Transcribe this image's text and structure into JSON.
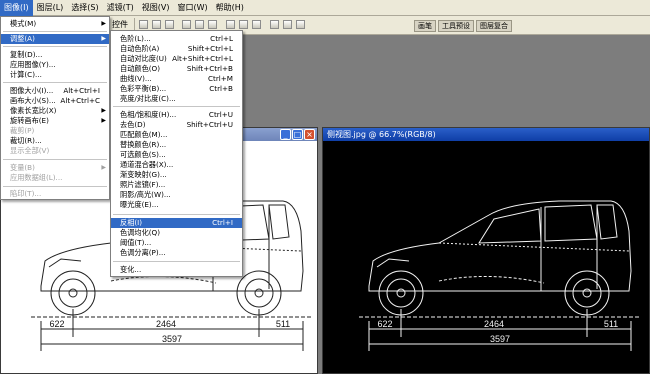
{
  "menubar": {
    "items": [
      "图像(I)",
      "图层(L)",
      "选择(S)",
      "滤镜(T)",
      "视图(V)",
      "窗口(W)",
      "帮助(H)"
    ],
    "active_index": 0
  },
  "options_bar": {
    "control_label": "控件",
    "tabs": [
      "画笔",
      "工具预设",
      "图层复合"
    ]
  },
  "image_menu": {
    "items": [
      {
        "label": "模式(M)",
        "shortcut": "",
        "submenu": true,
        "disabled": false,
        "highlight": false
      },
      {
        "label": "调整(A)",
        "shortcut": "",
        "submenu": true,
        "disabled": false,
        "highlight": true
      },
      {
        "label": "复制(D)...",
        "shortcut": "",
        "submenu": false,
        "disabled": false,
        "highlight": false
      },
      {
        "label": "应用图像(Y)...",
        "shortcut": "",
        "submenu": false,
        "disabled": false,
        "highlight": false
      },
      {
        "label": "计算(C)...",
        "shortcut": "",
        "submenu": false,
        "disabled": false,
        "highlight": false
      },
      {
        "label": "图像大小(I)...",
        "shortcut": "Alt+Ctrl+I",
        "submenu": false,
        "disabled": false,
        "highlight": false
      },
      {
        "label": "画布大小(S)...",
        "shortcut": "Alt+Ctrl+C",
        "submenu": false,
        "disabled": false,
        "highlight": false
      },
      {
        "label": "像素长宽比(X)",
        "shortcut": "",
        "submenu": true,
        "disabled": false,
        "highlight": false
      },
      {
        "label": "旋转画布(E)",
        "shortcut": "",
        "submenu": true,
        "disabled": false,
        "highlight": false
      },
      {
        "label": "裁剪(P)",
        "shortcut": "",
        "submenu": false,
        "disabled": true,
        "highlight": false
      },
      {
        "label": "裁切(R)...",
        "shortcut": "",
        "submenu": false,
        "disabled": false,
        "highlight": false
      },
      {
        "label": "显示全部(V)",
        "shortcut": "",
        "submenu": false,
        "disabled": true,
        "highlight": false
      },
      {
        "label": "变量(B)",
        "shortcut": "",
        "submenu": true,
        "disabled": true,
        "highlight": false
      },
      {
        "label": "应用数据组(L)...",
        "shortcut": "",
        "submenu": false,
        "disabled": true,
        "highlight": false
      },
      {
        "label": "陷印(T)...",
        "shortcut": "",
        "submenu": false,
        "disabled": true,
        "highlight": false
      }
    ]
  },
  "adjust_menu": {
    "items": [
      {
        "label": "色阶(L)...",
        "shortcut": "Ctrl+L",
        "highlight": false
      },
      {
        "label": "自动色阶(A)",
        "shortcut": "Shift+Ctrl+L",
        "highlight": false
      },
      {
        "label": "自动对比度(U)",
        "shortcut": "Alt+Shift+Ctrl+L",
        "highlight": false
      },
      {
        "label": "自动颜色(O)",
        "shortcut": "Shift+Ctrl+B",
        "highlight": false
      },
      {
        "label": "曲线(V)...",
        "shortcut": "Ctrl+M",
        "highlight": false
      },
      {
        "label": "色彩平衡(B)...",
        "shortcut": "Ctrl+B",
        "highlight": false
      },
      {
        "label": "亮度/对比度(C)...",
        "shortcut": "",
        "highlight": false
      },
      {
        "label": "色相/饱和度(H)...",
        "shortcut": "Ctrl+U",
        "highlight": false
      },
      {
        "label": "去色(D)",
        "shortcut": "Shift+Ctrl+U",
        "highlight": false
      },
      {
        "label": "匹配颜色(M)...",
        "shortcut": "",
        "highlight": false
      },
      {
        "label": "替换颜色(R)...",
        "shortcut": "",
        "highlight": false
      },
      {
        "label": "可选颜色(S)...",
        "shortcut": "",
        "highlight": false
      },
      {
        "label": "通道混合器(X)...",
        "shortcut": "",
        "highlight": false
      },
      {
        "label": "渐变映射(G)...",
        "shortcut": "",
        "highlight": false
      },
      {
        "label": "照片滤镜(F)...",
        "shortcut": "",
        "highlight": false
      },
      {
        "label": "阴影/高光(W)...",
        "shortcut": "",
        "highlight": false
      },
      {
        "label": "曝光度(E)...",
        "shortcut": "",
        "highlight": false
      },
      {
        "label": "反相(I)",
        "shortcut": "Ctrl+I",
        "highlight": true
      },
      {
        "label": "色调均化(Q)",
        "shortcut": "",
        "highlight": false
      },
      {
        "label": "阈值(T)...",
        "shortcut": "",
        "highlight": false
      },
      {
        "label": "色调分离(P)...",
        "shortcut": "",
        "highlight": false
      },
      {
        "label": "变化...",
        "shortcut": "",
        "highlight": false
      }
    ]
  },
  "left_window": {
    "dimensions": {
      "front": "622",
      "wheelbase": "2464",
      "rear": "511",
      "total": "3597"
    }
  },
  "right_window": {
    "title": "侧视图.jpg @ 66.7%(RGB/8)",
    "dimensions": {
      "front": "622",
      "wheelbase": "2464",
      "rear": "511",
      "total": "3597"
    }
  },
  "colors": {
    "highlight": "#316ac5",
    "menubar_bg": "#ece9d8",
    "workspace_bg": "#7d7d7d"
  }
}
